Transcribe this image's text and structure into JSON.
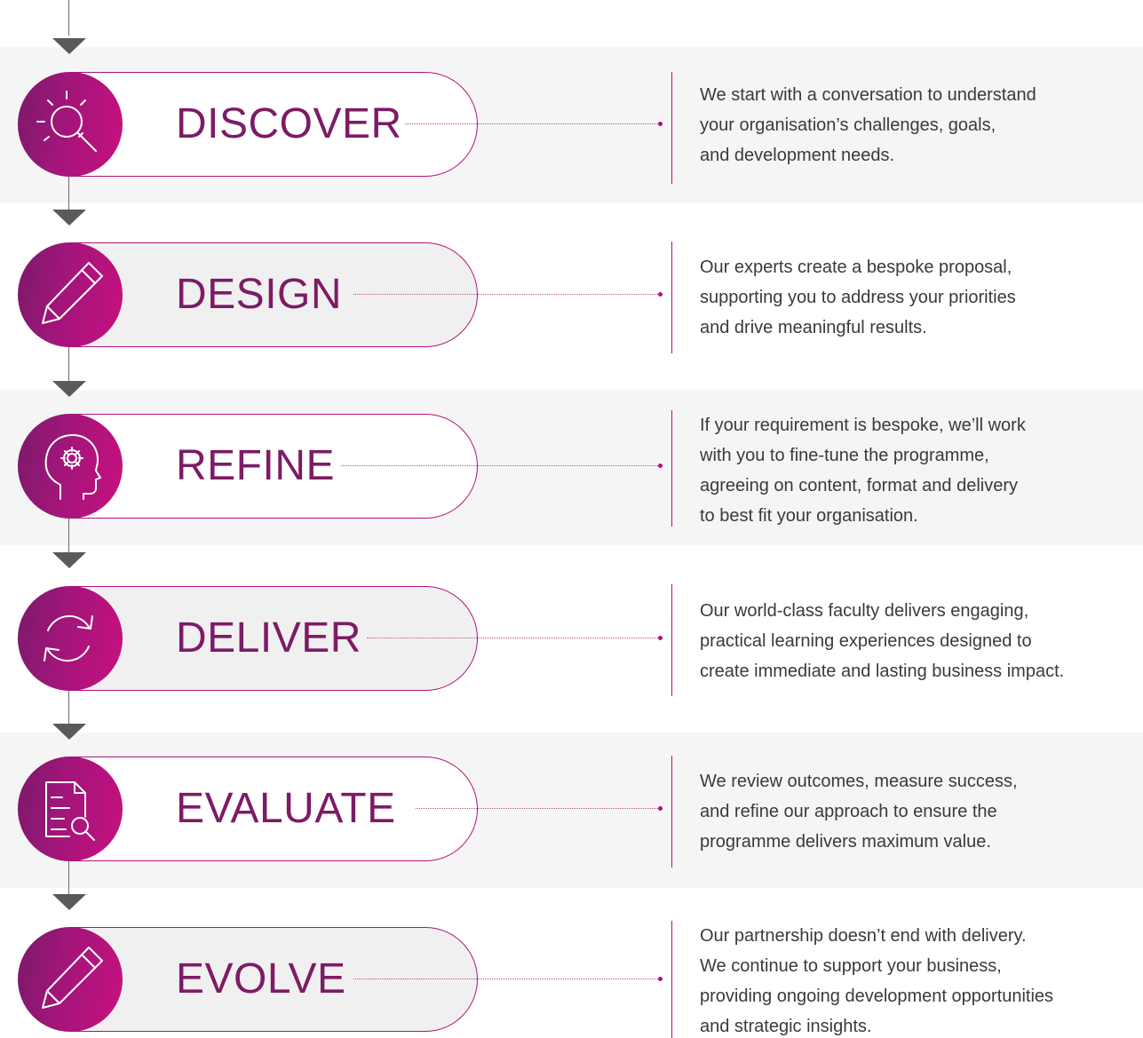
{
  "steps": [
    {
      "title": "DISCOVER",
      "icon": "magnifier-icon",
      "description": "We start with a conversation to understand\nyour organisation’s challenges, goals,\nand development needs."
    },
    {
      "title": "DESIGN",
      "icon": "pencil-icon",
      "description": "Our experts create a bespoke proposal,\nsupporting you to address your priorities\nand drive meaningful results."
    },
    {
      "title": "REFINE",
      "icon": "head-gear-icon",
      "description": "If your requirement is bespoke, we’ll work\nwith you to fine-tune the programme,\nagreeing on content, format and delivery\nto best fit your organisation."
    },
    {
      "title": "DELIVER",
      "icon": "refresh-icon",
      "description": "Our world-class faculty delivers engaging,\npractical learning experiences designed to\ncreate immediate and lasting business impact."
    },
    {
      "title": "EVALUATE",
      "icon": "document-search-icon",
      "description": "We review outcomes, measure success,\nand refine our approach to ensure the\nprogramme delivers maximum value."
    },
    {
      "title": "EVOLVE",
      "icon": "pencil-icon",
      "description": "Our partnership doesn’t end with delivery.\nWe continue to support your business,\nproviding ongoing development opportunities\nand strategic insights."
    }
  ],
  "colors": {
    "accent": "#b01278",
    "title": "#7d1b65",
    "gradient_start": "#7a1a6a",
    "gradient_end": "#c8117f",
    "arrow": "#5a5a5a",
    "band": "#f5f5f5"
  }
}
